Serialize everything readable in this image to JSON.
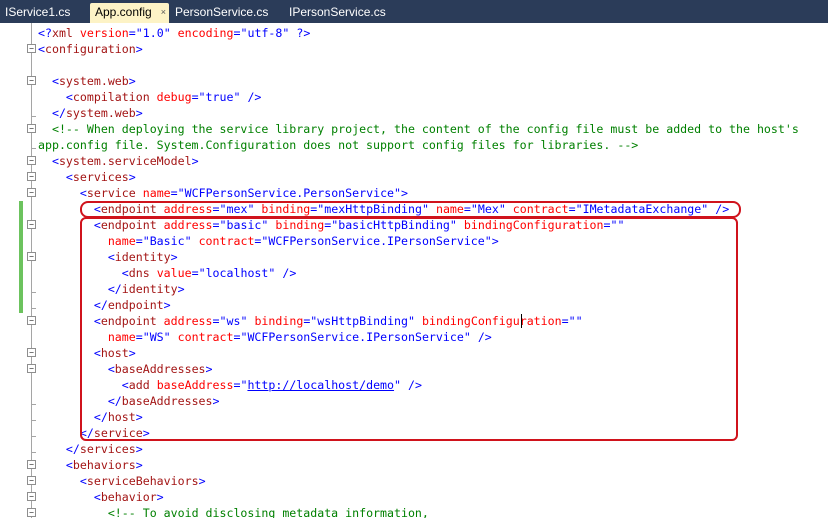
{
  "tabs": [
    {
      "label": "IService1.cs",
      "active": false
    },
    {
      "label": "App.config",
      "active": true
    },
    {
      "label": "PersonService.cs",
      "active": false
    },
    {
      "label": "IPersonService.cs",
      "active": false
    }
  ],
  "tab_close_glyph": "×",
  "code": {
    "xml_decl": {
      "open": "<?",
      "name": "xml",
      "attr1": "version",
      "val1": "1.0",
      "attr2": "encoding",
      "val2": "utf-8",
      "close": "?>"
    },
    "configuration": "configuration",
    "system_web": "system.web",
    "compilation": "compilation",
    "debug_attr": "debug",
    "debug_val": "true",
    "comment_line1": "<!-- When deploying the service library project, the content of the config file must be added to the host's",
    "comment_line2": "app.config file. System.Configuration does not support config files for libraries. -->",
    "system_servicemodel": "system.serviceModel",
    "services": "services",
    "service": "service",
    "name_attr": "name",
    "service_name": "WCFPersonService.PersonService",
    "endpoint": "endpoint",
    "address_attr": "address",
    "binding_attr": "binding",
    "bindingconfig_attr": "bindingConfiguration",
    "contract_attr": "contract",
    "mex_address": "mex",
    "mex_binding": "mexHttpBinding",
    "mex_name": "Mex",
    "mex_contract": "IMetadataExchange",
    "basic_address": "basic",
    "basic_binding": "basicHttpBinding",
    "basic_name": "Basic",
    "person_contract": "WCFPersonService.IPersonService",
    "identity": "identity",
    "dns": "dns",
    "value_attr": "value",
    "dns_value": "localhost",
    "ws_address": "ws",
    "ws_binding": "wsHttpBinding",
    "ws_name": "WS",
    "host": "host",
    "base_addresses": "baseAddresses",
    "add": "add",
    "base_address_attr": "baseAddress",
    "base_address_val": "http://localhost/demo",
    "behaviors": "behaviors",
    "service_behaviors": "serviceBehaviors",
    "behavior": "behavior",
    "comment_metadata": "<!-- To avoid disclosing metadata information,"
  },
  "colors": {
    "tag": "#a31515",
    "punct": "#0000ff",
    "attr": "#ff0000",
    "value": "#0000ff",
    "comment": "#008000",
    "highlight_box": "#d0131c",
    "change_bar": "#6cc35e",
    "tab_bar": "#2b3c59",
    "active_tab": "#fdf3c6"
  },
  "icons": {
    "fold_collapse": "minus-box-icon"
  }
}
